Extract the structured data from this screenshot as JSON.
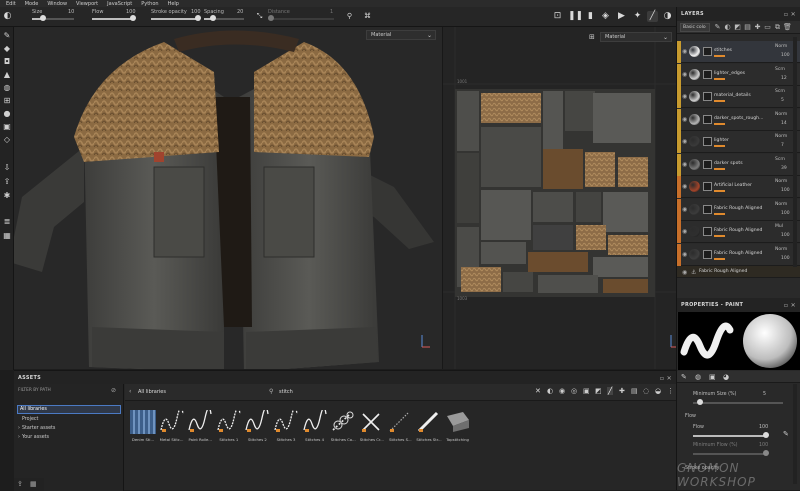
{
  "menu": [
    "Edit",
    "Mode",
    "Window",
    "Viewport",
    "JavaScript",
    "Python",
    "Help"
  ],
  "toolbar": {
    "size_label": "Size",
    "size_value": "10",
    "flow_label": "Flow",
    "flow_value": "100",
    "stroke_opacity_label": "Stroke opacity",
    "stroke_opacity_value": "100",
    "spacing_label": "Spacing",
    "spacing_value": "20",
    "distance_label": "Distance",
    "distance_value": "1"
  },
  "viewport": {
    "material_dropdown_3d": "Material",
    "material_dropdown_uv": "Material",
    "uv_tile_label_a": "1001",
    "uv_tile_label_b": "1003"
  },
  "layers": {
    "title": "LAYERS",
    "channel": "Basic colo",
    "items": [
      {
        "name": "stitches",
        "blend": "Norm",
        "opacity": "100",
        "strip": "#c79b2f",
        "thumb": "#f2f2f2"
      },
      {
        "name": "lighter_edges",
        "blend": "Scrn",
        "opacity": "12",
        "strip": "#c79b2f",
        "thumb": "#cfcfcf"
      },
      {
        "name": "material_details",
        "blend": "Scrn",
        "opacity": "5",
        "strip": "#c79b2f",
        "thumb": "#cfcfcf"
      },
      {
        "name": "darker_spots_rough...",
        "blend": "Norm",
        "opacity": "14",
        "strip": "#c79b2f",
        "thumb": "#b5b5b5"
      },
      {
        "name": "lighter",
        "blend": "Norm",
        "opacity": "7",
        "strip": "#c79b2f",
        "thumb": "#3a3a3a"
      },
      {
        "name": "darker spots",
        "blend": "Scrn",
        "opacity": "39",
        "strip": "#c79b2f",
        "thumb": "#7a7a7a"
      },
      {
        "name": "Artificial Leather",
        "blend": "Norm",
        "opacity": "100",
        "strip": "#c76f2a",
        "thumb": "#a2442a"
      },
      {
        "name": "Fabric Rough Aligned",
        "blend": "Norm",
        "opacity": "100",
        "strip": "#c76f2a",
        "thumb": "#3c3c3c"
      },
      {
        "name": "Fabric Rough Aligned",
        "blend": "Mul",
        "opacity": "100",
        "strip": "#c76f2a",
        "thumb": "#2f2f2f"
      },
      {
        "name": "Fabric Rough Aligned",
        "blend": "Norm",
        "opacity": "100",
        "strip": "#c76f2a",
        "thumb": "#3e3e3e"
      }
    ],
    "bottom_item": "Fabric Rough Aligned"
  },
  "properties": {
    "title": "PROPERTIES - PAINT",
    "min_size_label": "Minimum Size (%)",
    "min_size_value": "5",
    "flow_section": "Flow",
    "flow_label": "Flow",
    "flow_value": "100",
    "min_flow_label": "Minimum Flow (%)",
    "min_flow_value": "100",
    "stroke_opacity_label": "Stroke opacity"
  },
  "assets": {
    "title": "ASSETS",
    "filter_title": "FILTER BY PATH",
    "paths": [
      "All libraries",
      "Project",
      "Starter assets",
      "Your assets"
    ],
    "breadcrumb": "All libraries",
    "search_value": "stitch",
    "items": [
      "Denim Sti...",
      "Metal Stitc...",
      "Paint Rolle...",
      "Stitches 1",
      "Stitches 2",
      "Stitches 3",
      "Stitches 4",
      "Stitches Co...",
      "Stitches Cr...",
      "Stitches S...",
      "Stitches Str...",
      "Topstitching"
    ]
  },
  "watermark": "GNOMON WORKSHOP"
}
